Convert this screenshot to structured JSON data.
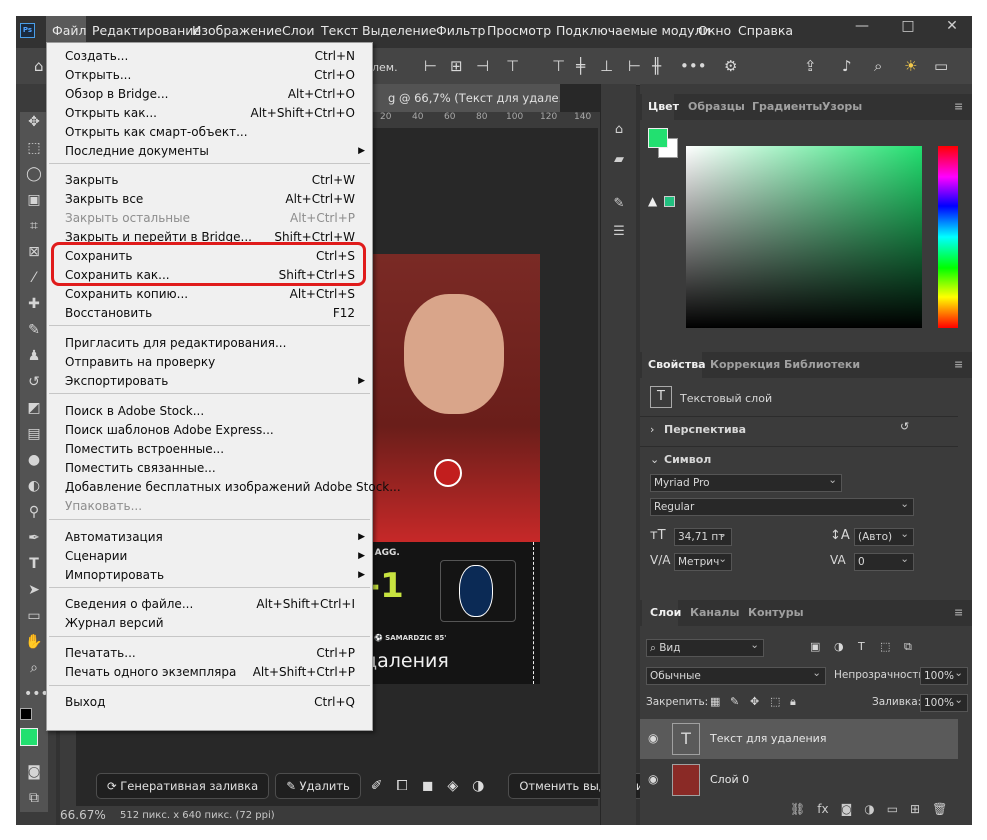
{
  "app": {
    "logo": "Ps"
  },
  "menubar": {
    "items": [
      "Файл",
      "Редактирование",
      "Изображение",
      "Слои",
      "Текст",
      "Выделение",
      "Фильтр",
      "Просмотр",
      "Подключаемые модули",
      "Окно",
      "Справка"
    ],
    "active": "Файл"
  },
  "window": {
    "minimize": "—",
    "maximize": "□",
    "close": "✕"
  },
  "options_bar": {
    "partial_label": "лем."
  },
  "document": {
    "tab_title": "g @ 66,7% (Текст для удале...",
    "tab_close": "✕",
    "ruler_ticks": [
      "20",
      "40",
      "60",
      "80",
      "100",
      "120",
      "140"
    ],
    "canvas": {
      "agg_text": "N AGG.",
      "score": "-1",
      "scorer": "⚽ SAMARDZIC 85'",
      "caption": "даления"
    },
    "status_zoom": "66.67%",
    "status_info": "512 пикс. x 640 пикс. (72 ppi)"
  },
  "context_bar": {
    "generative_fill": "Генеративная заливка",
    "delete": "Удалить",
    "deselect": "Отменить выделение"
  },
  "file_menu": {
    "items": [
      {
        "label": "Создать...",
        "shortcut": "Ctrl+N"
      },
      {
        "label": "Открыть...",
        "shortcut": "Ctrl+O"
      },
      {
        "label": "Обзор в Bridge...",
        "shortcut": "Alt+Ctrl+O"
      },
      {
        "label": "Открыть как...",
        "shortcut": "Alt+Shift+Ctrl+O"
      },
      {
        "label": "Открыть как смарт-объект...",
        "shortcut": ""
      },
      {
        "label": "Последние документы",
        "shortcut": "",
        "submenu": true
      },
      {
        "label": "Закрыть",
        "shortcut": "Ctrl+W"
      },
      {
        "label": "Закрыть все",
        "shortcut": "Alt+Ctrl+W"
      },
      {
        "label": "Закрыть остальные",
        "shortcut": "Alt+Ctrl+P",
        "disabled": true
      },
      {
        "label": "Закрыть и перейти в Bridge...",
        "shortcut": "Shift+Ctrl+W"
      },
      {
        "label": "Сохранить",
        "shortcut": "Ctrl+S"
      },
      {
        "label": "Сохранить как...",
        "shortcut": "Shift+Ctrl+S"
      },
      {
        "label": "Сохранить копию...",
        "shortcut": "Alt+Ctrl+S"
      },
      {
        "label": "Восстановить",
        "shortcut": "F12"
      },
      {
        "label": "Пригласить для редактирования...",
        "shortcut": ""
      },
      {
        "label": "Отправить на проверку",
        "shortcut": ""
      },
      {
        "label": "Экспортировать",
        "shortcut": "",
        "submenu": true
      },
      {
        "label": "Поиск в Adobe Stock...",
        "shortcut": ""
      },
      {
        "label": "Поиск шаблонов Adobe Express...",
        "shortcut": ""
      },
      {
        "label": "Поместить встроенные...",
        "shortcut": ""
      },
      {
        "label": "Поместить связанные...",
        "shortcut": ""
      },
      {
        "label": "Добавление бесплатных изображений Adobe Stock...",
        "shortcut": ""
      },
      {
        "label": "Упаковать...",
        "shortcut": "",
        "disabled": true
      },
      {
        "label": "Автоматизация",
        "shortcut": "",
        "submenu": true
      },
      {
        "label": "Сценарии",
        "shortcut": "",
        "submenu": true
      },
      {
        "label": "Импортировать",
        "shortcut": "",
        "submenu": true
      },
      {
        "label": "Сведения о файле...",
        "shortcut": "Alt+Shift+Ctrl+I"
      },
      {
        "label": "Журнал версий",
        "shortcut": ""
      },
      {
        "label": "Печатать...",
        "shortcut": "Ctrl+P"
      },
      {
        "label": "Печать одного экземпляра",
        "shortcut": "Alt+Shift+Ctrl+P"
      },
      {
        "label": "Выход",
        "shortcut": "Ctrl+Q"
      }
    ],
    "highlight_color": "#e01b1b"
  },
  "color_panel": {
    "tabs": [
      "Цвет",
      "Образцы",
      "Градиенты",
      "Узоры"
    ],
    "foreground": "#22e070",
    "background": "#ffffff"
  },
  "properties_panel": {
    "tabs": [
      "Свойства",
      "Коррекция",
      "Библиотеки"
    ],
    "layer_type": "Текстовый слой",
    "perspective": "Перспектива",
    "symbol": "Символ",
    "font_family": "Myriad Pro",
    "font_style": "Regular",
    "font_size": "34,71 пт",
    "leading": "(Авто)",
    "kerning": "Метрич",
    "tracking": "0"
  },
  "layers_panel": {
    "tabs": [
      "Слои",
      "Каналы",
      "Контуры"
    ],
    "filter": "Вид",
    "blend_mode": "Обычные",
    "opacity_label": "Непрозрачность:",
    "opacity": "100%",
    "lock_label": "Закрепить:",
    "fill_label": "Заливка:",
    "fill": "100%",
    "layers": [
      {
        "name": "Текст для удаления",
        "thumb": "T",
        "selected": true
      },
      {
        "name": "Слой 0",
        "thumb": "",
        "selected": false
      }
    ]
  }
}
